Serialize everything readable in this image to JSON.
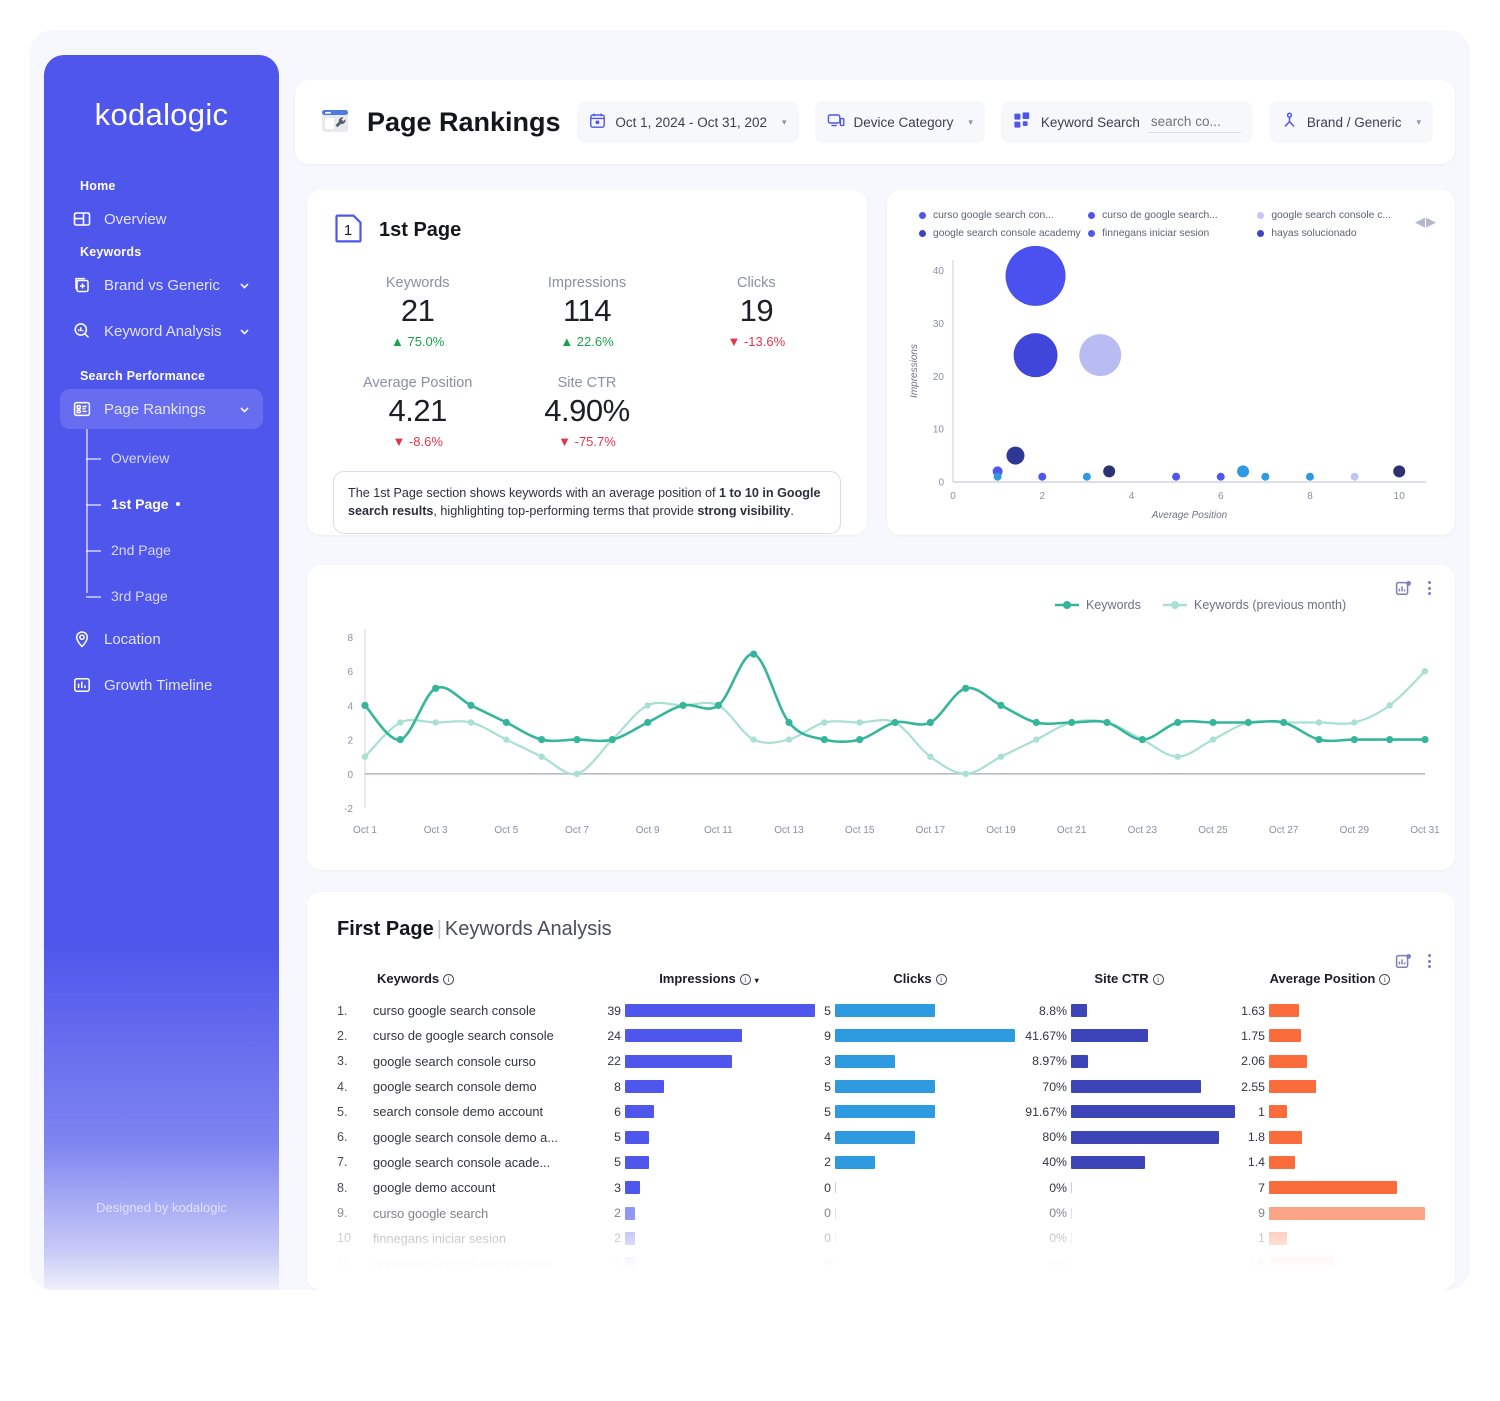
{
  "sidebar": {
    "logo": "kodalogic",
    "credit": "Designed by kodalogic",
    "sections": [
      {
        "label": "Home"
      },
      {
        "label": "Keywords"
      },
      {
        "label": "Search Performance"
      }
    ],
    "items": {
      "overview": "Overview",
      "brand_vs_generic": "Brand vs Generic",
      "keyword_analysis": "Keyword Analysis",
      "page_rankings": "Page Rankings",
      "location": "Location",
      "growth_timeline": "Growth Timeline"
    },
    "sub_items": [
      {
        "label": "Overview",
        "active": false
      },
      {
        "label": "1st Page",
        "active": true
      },
      {
        "label": "2nd Page",
        "active": false
      },
      {
        "label": "3rd Page",
        "active": false
      }
    ]
  },
  "header": {
    "title": "Page Rankings",
    "date_filter": "Oct 1, 2024 - Oct 31, 202",
    "device_filter": "Device Category",
    "keyword_search_label": "Keyword Search",
    "keyword_search_placeholder": "search co...",
    "brand_filter": "Brand / Generic"
  },
  "kpi": {
    "title": "1st Page",
    "badge": "1",
    "metrics": [
      {
        "label": "Keywords",
        "value": "21",
        "delta": "75.0%",
        "dir": "up"
      },
      {
        "label": "Impressions",
        "value": "114",
        "delta": "22.6%",
        "dir": "up"
      },
      {
        "label": "Clicks",
        "value": "19",
        "delta": "-13.6%",
        "dir": "down"
      },
      {
        "label": "Average Position",
        "value": "4.21",
        "delta": "-8.6%",
        "dir": "down"
      },
      {
        "label": "Site CTR",
        "value": "4.90%",
        "delta": "-75.7%",
        "dir": "down"
      }
    ],
    "description": {
      "part1": "The 1st Page section shows keywords with an average position of ",
      "bold1": "1 to 10 in Google search results",
      "part2": ", highlighting top-performing terms that provide ",
      "bold2": "strong visibility",
      "part3": "."
    }
  },
  "chart_data": [
    {
      "type": "scatter",
      "name": "keyword-bubble-chart",
      "title": "",
      "xlabel": "Average Position",
      "ylabel": "Impressions",
      "xlim": [
        0,
        10.6
      ],
      "ylim": [
        0,
        42
      ],
      "xticks": [
        0,
        2,
        4,
        6,
        8,
        10
      ],
      "yticks": [
        0,
        10,
        20,
        30,
        40
      ],
      "legend": [
        {
          "label": "curso google search con...",
          "color": "#4f56ec"
        },
        {
          "label": "curso de google search...",
          "color": "#4f56ec"
        },
        {
          "label": "google search console c...",
          "color": "#c3c5f4"
        },
        {
          "label": "google search console academy",
          "color": "#3f45c9"
        },
        {
          "label": "finnegans iniciar sesion",
          "color": "#4f56ec"
        },
        {
          "label": "hayas solucionado",
          "color": "#3f45c9"
        }
      ],
      "points": [
        {
          "x": 1.85,
          "y": 39,
          "r": 30,
          "color": "#4a51ef"
        },
        {
          "x": 1.85,
          "y": 24,
          "r": 22,
          "color": "#4046d9"
        },
        {
          "x": 3.3,
          "y": 24,
          "r": 21,
          "color": "#b9bcf2"
        },
        {
          "x": 1.4,
          "y": 5,
          "r": 9,
          "color": "#2f3694"
        },
        {
          "x": 1.0,
          "y": 2,
          "r": 5,
          "color": "#4f56ec"
        },
        {
          "x": 1.0,
          "y": 1,
          "r": 4,
          "color": "#2e9ae0"
        },
        {
          "x": 2.0,
          "y": 1,
          "r": 4,
          "color": "#4f56ec"
        },
        {
          "x": 3.0,
          "y": 1,
          "r": 4,
          "color": "#2e9ae0"
        },
        {
          "x": 3.5,
          "y": 2,
          "r": 6,
          "color": "#2b3370"
        },
        {
          "x": 5.0,
          "y": 1,
          "r": 4,
          "color": "#4f56ec"
        },
        {
          "x": 6.0,
          "y": 1,
          "r": 4,
          "color": "#4f56ec"
        },
        {
          "x": 6.5,
          "y": 2,
          "r": 6,
          "color": "#2e9ae0"
        },
        {
          "x": 7.0,
          "y": 1,
          "r": 4,
          "color": "#2e9ae0"
        },
        {
          "x": 8.0,
          "y": 1,
          "r": 4,
          "color": "#2e9ae0"
        },
        {
          "x": 9.0,
          "y": 1,
          "r": 4,
          "color": "#c3c5f4"
        },
        {
          "x": 10.0,
          "y": 2,
          "r": 6,
          "color": "#2b3370"
        }
      ]
    },
    {
      "type": "line",
      "name": "keywords-timeline",
      "title": "",
      "xlabel": "",
      "ylabel": "",
      "ylim": [
        -2,
        8
      ],
      "yticks": [
        -2,
        0,
        2,
        4,
        6,
        8
      ],
      "xtick_labels": [
        "Oct 1",
        "Oct 3",
        "Oct 5",
        "Oct 7",
        "Oct 9",
        "Oct 11",
        "Oct 13",
        "Oct 15",
        "Oct 17",
        "Oct 19",
        "Oct 21",
        "Oct 23",
        "Oct 25",
        "Oct 27",
        "Oct 29",
        "Oct 31"
      ],
      "x": [
        1,
        2,
        3,
        4,
        5,
        6,
        7,
        8,
        9,
        10,
        11,
        12,
        13,
        14,
        15,
        16,
        17,
        18,
        19,
        20,
        21,
        22,
        23,
        24,
        25,
        26,
        27,
        28,
        29,
        30,
        31
      ],
      "legend_position": "top-right",
      "series": [
        {
          "name": "Keywords",
          "color": "#35b69b",
          "values": [
            4,
            2,
            5,
            4,
            3,
            2,
            2,
            2,
            3,
            4,
            4,
            7,
            3,
            2,
            2,
            3,
            3,
            5,
            4,
            3,
            3,
            3,
            2,
            3,
            3,
            3,
            3,
            2,
            2,
            2,
            2
          ]
        },
        {
          "name": "Keywords (previous month)",
          "color": "#a9e0d2",
          "values": [
            1,
            3,
            3,
            3,
            2,
            1,
            0,
            2,
            4,
            4,
            4,
            2,
            2,
            3,
            3,
            3,
            1,
            0,
            1,
            2,
            3,
            3,
            2,
            1,
            2,
            3,
            3,
            3,
            3,
            4,
            6
          ]
        }
      ]
    },
    {
      "type": "bar",
      "name": "first-page-keywords-analysis",
      "title": "First Page | Keywords Analysis",
      "categories": [
        "curso google search console",
        "curso de google search console",
        "google search console curso",
        "google search console demo",
        "search console demo account",
        "google search console demo a...",
        "google search console acade...",
        "google demo account",
        "curso google search",
        "finnegans iniciar sesion",
        "respuestas cursos medicarama"
      ],
      "series": [
        {
          "name": "Impressions",
          "values": [
            39,
            24,
            22,
            8,
            6,
            5,
            5,
            3,
            2,
            2,
            2
          ]
        },
        {
          "name": "Clicks",
          "values": [
            5,
            9,
            3,
            5,
            5,
            4,
            2,
            0,
            0,
            0,
            0
          ]
        },
        {
          "name": "Site CTR",
          "values": [
            8.8,
            41.67,
            8.97,
            70,
            91.67,
            80,
            40,
            0,
            0,
            0,
            0
          ]
        },
        {
          "name": "Average Position",
          "values": [
            1.63,
            1.75,
            2.06,
            2.55,
            1,
            1.8,
            1.4,
            7,
            9,
            1,
            3.5
          ]
        }
      ]
    }
  ],
  "table": {
    "title_bold": "First Page",
    "title_sep": "|",
    "title_rest": "Keywords Analysis",
    "columns": [
      "Keywords",
      "Impressions",
      "Clicks",
      "Site CTR",
      "Average Position"
    ],
    "rows": [
      {
        "idx": "1.",
        "keyword": "curso google search console",
        "impressions": "39",
        "clicks": "5",
        "ctr": "8.8%",
        "position": "1.63"
      },
      {
        "idx": "2.",
        "keyword": "curso de google search console",
        "impressions": "24",
        "clicks": "9",
        "ctr": "41.67%",
        "position": "1.75"
      },
      {
        "idx": "3.",
        "keyword": "google search console curso",
        "impressions": "22",
        "clicks": "3",
        "ctr": "8.97%",
        "position": "2.06"
      },
      {
        "idx": "4.",
        "keyword": "google search console demo",
        "impressions": "8",
        "clicks": "5",
        "ctr": "70%",
        "position": "2.55"
      },
      {
        "idx": "5.",
        "keyword": "search console demo account",
        "impressions": "6",
        "clicks": "5",
        "ctr": "91.67%",
        "position": "1"
      },
      {
        "idx": "6.",
        "keyword": "google search console demo a...",
        "impressions": "5",
        "clicks": "4",
        "ctr": "80%",
        "position": "1.8"
      },
      {
        "idx": "7.",
        "keyword": "google search console acade...",
        "impressions": "5",
        "clicks": "2",
        "ctr": "40%",
        "position": "1.4"
      },
      {
        "idx": "8.",
        "keyword": "google demo account",
        "impressions": "3",
        "clicks": "0",
        "ctr": "0%",
        "position": "7"
      },
      {
        "idx": "9.",
        "keyword": "curso google search",
        "impressions": "2",
        "clicks": "0",
        "ctr": "0%",
        "position": "9"
      },
      {
        "idx": "10",
        "keyword": "finnegans iniciar sesion",
        "impressions": "2",
        "clicks": "0",
        "ctr": "0%",
        "position": "1"
      },
      {
        "idx": "11.",
        "keyword": "respuestas cursos medicarama",
        "impressions": "2",
        "clicks": "0",
        "ctr": "0%",
        "position": "3.5"
      }
    ]
  },
  "colors": {
    "brand": "#4f56ec",
    "impressions_bar": "#4f56ec",
    "clicks_bar": "#2e9ae0",
    "ctr_bar": "#3b45b8",
    "position_bar": "#fa6c3c",
    "up": "#17a34a",
    "down": "#e0364c"
  }
}
